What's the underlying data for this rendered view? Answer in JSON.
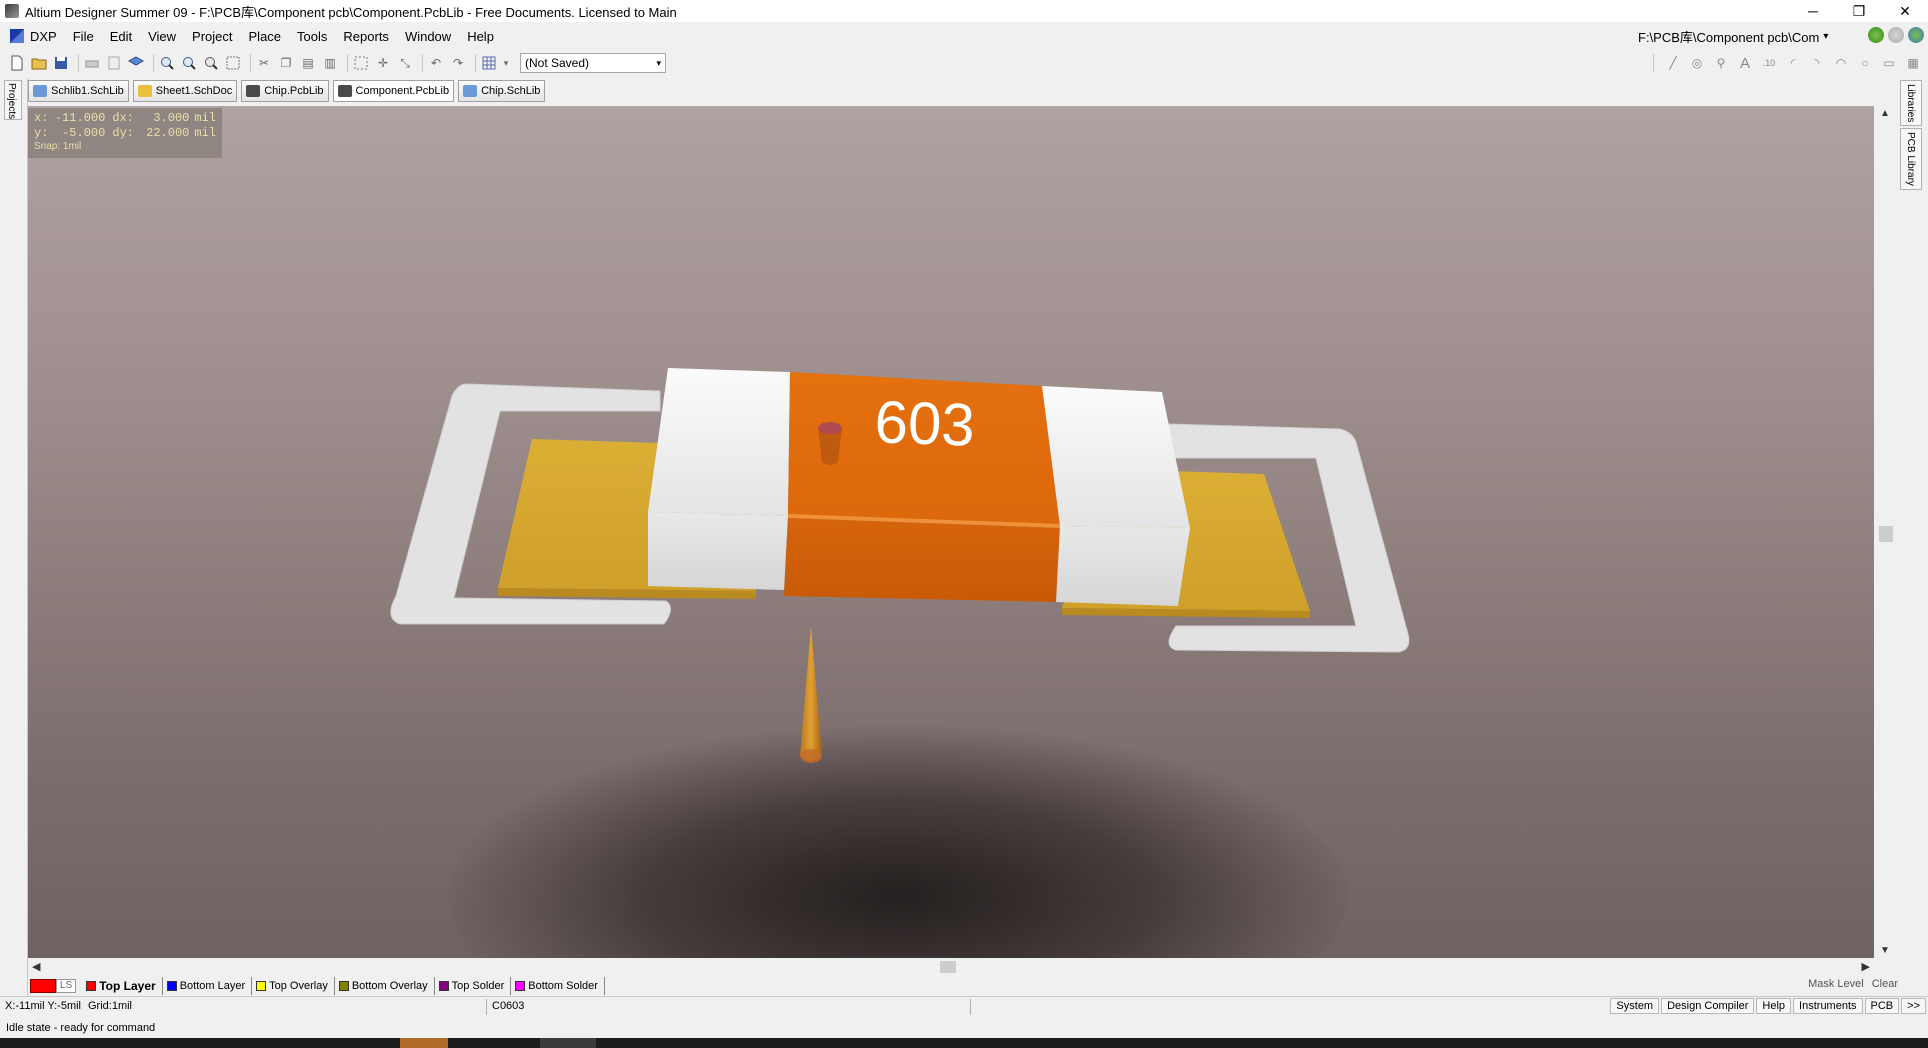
{
  "window": {
    "title": "Altium Designer Summer 09 - F:\\PCB库\\Component pcb\\Component.PcbLib - Free Documents. Licensed to Main",
    "minimize": "─",
    "restore": "❐",
    "close": "✕"
  },
  "menu": {
    "items": [
      "DXP",
      "File",
      "Edit",
      "View",
      "Project",
      "Place",
      "Tools",
      "Reports",
      "Window",
      "Help"
    ],
    "path": "F:\\PCB库\\Component pcb\\Com",
    "path_arrow": "▾"
  },
  "toolbar": {
    "view_select": "(Not Saved)",
    "select_arrow": "▾"
  },
  "doc_tabs": [
    {
      "label": "Schlib1.SchLib",
      "color": "#6a9ad8"
    },
    {
      "label": "Sheet1.SchDoc",
      "color": "#e8c040"
    },
    {
      "label": "Chip.PcbLib",
      "color": "#4a4a4a"
    },
    {
      "label": "Component.PcbLib",
      "color": "#4a4a4a"
    },
    {
      "label": "Chip.SchLib",
      "color": "#6a9ad8"
    }
  ],
  "left_panel": {
    "tab": "Projects"
  },
  "right_panel": {
    "tabs": [
      "Libraries",
      "PCB Library"
    ]
  },
  "coords": {
    "x_label": "x:",
    "x_value": "-11.000",
    "dx_label": "dx:",
    "dx_value": "3.000",
    "unit1": "mil",
    "y_label": "y:",
    "y_value": "-5.000",
    "dy_label": "dy:",
    "dy_value": "22.000",
    "unit2": "mil",
    "snap": "Snap: 1mil"
  },
  "component": {
    "marking": "603",
    "body_color": "#e06a10",
    "terminal_color": "#f2f2f2",
    "pad_color": "#d6a830",
    "outline_color": "#e6e6e6"
  },
  "layers": {
    "ls": "LS",
    "tabs": [
      {
        "label": "Top Layer",
        "color": "#ff0000",
        "active": true
      },
      {
        "label": "Bottom Layer",
        "color": "#0000ff",
        "active": false
      },
      {
        "label": "Top Overlay",
        "color": "#ffff00",
        "active": false
      },
      {
        "label": "Bottom Overlay",
        "color": "#808000",
        "active": false
      },
      {
        "label": "Top Solder",
        "color": "#800080",
        "active": false
      },
      {
        "label": "Bottom Solder",
        "color": "#ff00ff",
        "active": false
      }
    ],
    "mask_level": "Mask Level",
    "clear": "Clear"
  },
  "status": {
    "xy": "X:-11mil Y:-5mil",
    "grid": "Grid:1mil",
    "component": "C0603",
    "buttons": [
      "System",
      "Design Compiler",
      "Help",
      "Instruments",
      "PCB",
      ">>"
    ],
    "idle": "Idle state - ready for command"
  }
}
